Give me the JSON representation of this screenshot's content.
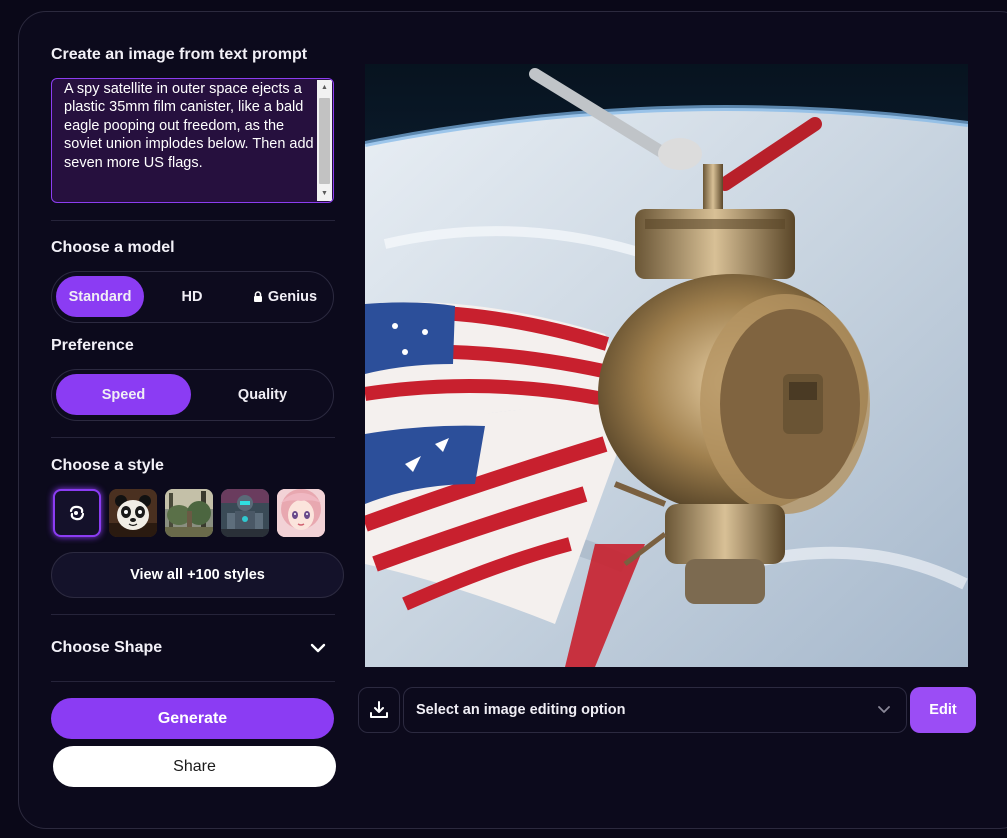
{
  "prompt": {
    "heading": "Create an image from text prompt",
    "text": "A spy satellite in outer space ejects a plastic 35mm film canister, like a bald eagle pooping out freedom, as the soviet union implodes below. Then add seven more US flags."
  },
  "model": {
    "heading": "Choose a model",
    "options": [
      "Standard",
      "HD",
      "Genius"
    ],
    "selected": "Standard",
    "locked_icon": "lock-icon"
  },
  "preference": {
    "heading": "Preference",
    "options": [
      "Speed",
      "Quality"
    ],
    "selected": "Speed"
  },
  "style": {
    "heading": "Choose a style",
    "thumbnails": [
      "no-style-icon",
      "panda-style",
      "forest-style",
      "robot-style",
      "anime-girl-style"
    ],
    "selected_index": 0,
    "view_all_label": "View all +100 styles"
  },
  "shape": {
    "heading": "Choose Shape",
    "icon": "chevron-down-icon"
  },
  "actions": {
    "generate_label": "Generate",
    "share_label": "Share"
  },
  "editor": {
    "download_icon": "download-icon",
    "select_placeholder": "Select an image editing option",
    "edit_label": "Edit"
  },
  "colors": {
    "accent": "#8b3cf3",
    "background": "#0c0a1c",
    "prompt_bg": "#26103e"
  }
}
